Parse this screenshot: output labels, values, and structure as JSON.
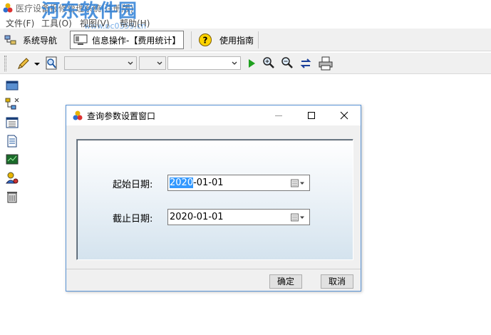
{
  "window": {
    "title": "医疗设备报修管理系统(注册版)",
    "watermark": "河东软件园",
    "watermark_sub": "www.pc0359.cn"
  },
  "menu": {
    "items": [
      "文件(F)",
      "工具(O)",
      "视图(V)",
      "帮助(H)"
    ]
  },
  "navbar": {
    "nav_label": "系统导航",
    "info_label": "信息操作-【费用统计】",
    "guide_label": "使用指南"
  },
  "toolbar": {
    "combo1_value": "",
    "combo2_value": "",
    "combo3_value": ""
  },
  "dialog": {
    "title": "查询参数设置窗口",
    "start_label": "起始日期:",
    "start_year": "2020",
    "start_rest": "-01-01",
    "end_label": "截止日期:",
    "end_value": "2020-01-01",
    "ok_label": "确定",
    "cancel_label": "取消"
  },
  "colors": {
    "accent": "#3399ff",
    "dialog_border": "#5a94d6",
    "watermark": "#2d7fd6"
  }
}
